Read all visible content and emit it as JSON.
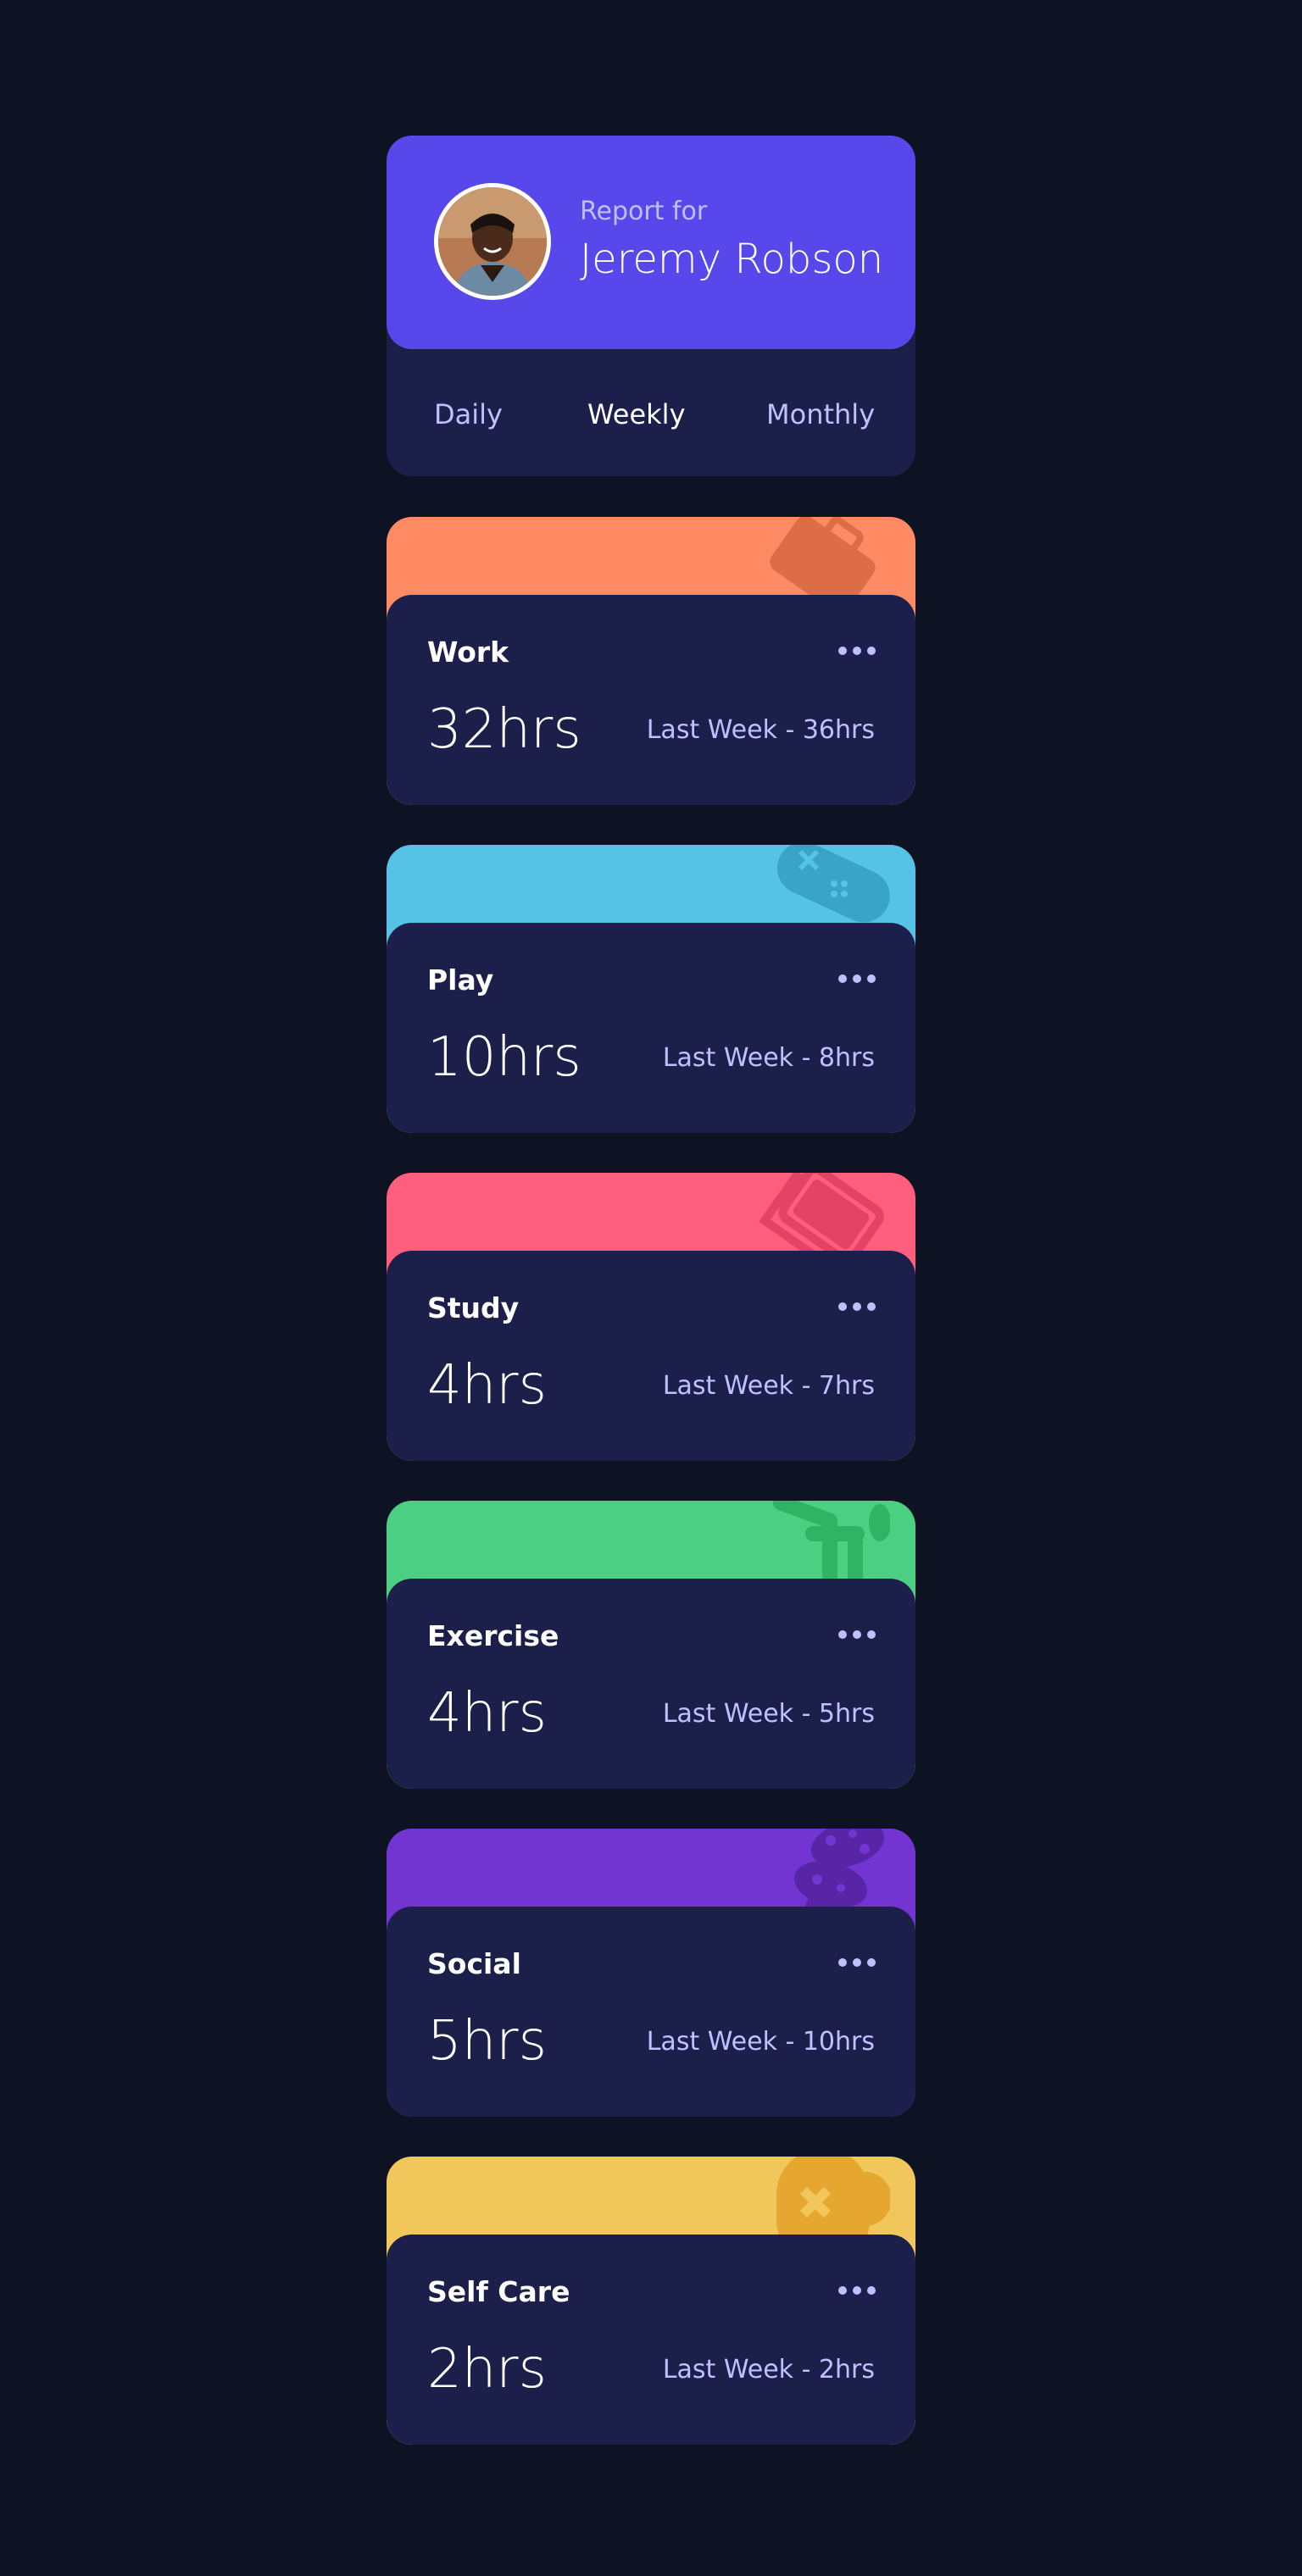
{
  "profile": {
    "report_for": "Report for",
    "name": "Jeremy Robson",
    "avatar_icon": "user-avatar-photo"
  },
  "tabs": [
    {
      "label": "Daily",
      "active": false
    },
    {
      "label": "Weekly",
      "active": true
    },
    {
      "label": "Monthly",
      "active": false
    }
  ],
  "cards": [
    {
      "title": "Work",
      "hours": "32hrs",
      "last_week": "Last Week - 36hrs",
      "color": "#ff8b64",
      "icon": "briefcase-icon"
    },
    {
      "title": "Play",
      "hours": "10hrs",
      "last_week": "Last Week - 8hrs",
      "color": "#55c2e6",
      "icon": "gamepad-icon"
    },
    {
      "title": "Study",
      "hours": "4hrs",
      "last_week": "Last Week - 7hrs",
      "color": "#ff5e7d",
      "icon": "book-icon"
    },
    {
      "title": "Exercise",
      "hours": "4hrs",
      "last_week": "Last Week - 5hrs",
      "color": "#4bcf82",
      "icon": "running-icon"
    },
    {
      "title": "Social",
      "hours": "5hrs",
      "last_week": "Last Week - 10hrs",
      "color": "#7335d2",
      "icon": "chat-bubbles-icon"
    },
    {
      "title": "Self Care",
      "hours": "2hrs",
      "last_week": "Last Week - 2hrs",
      "color": "#f1c75b",
      "icon": "heart-icon"
    }
  ],
  "colors": {
    "background": "#0e1323",
    "card": "#1c1f4a",
    "accent": "#5847eb",
    "muted_text": "#bdc1ff"
  }
}
